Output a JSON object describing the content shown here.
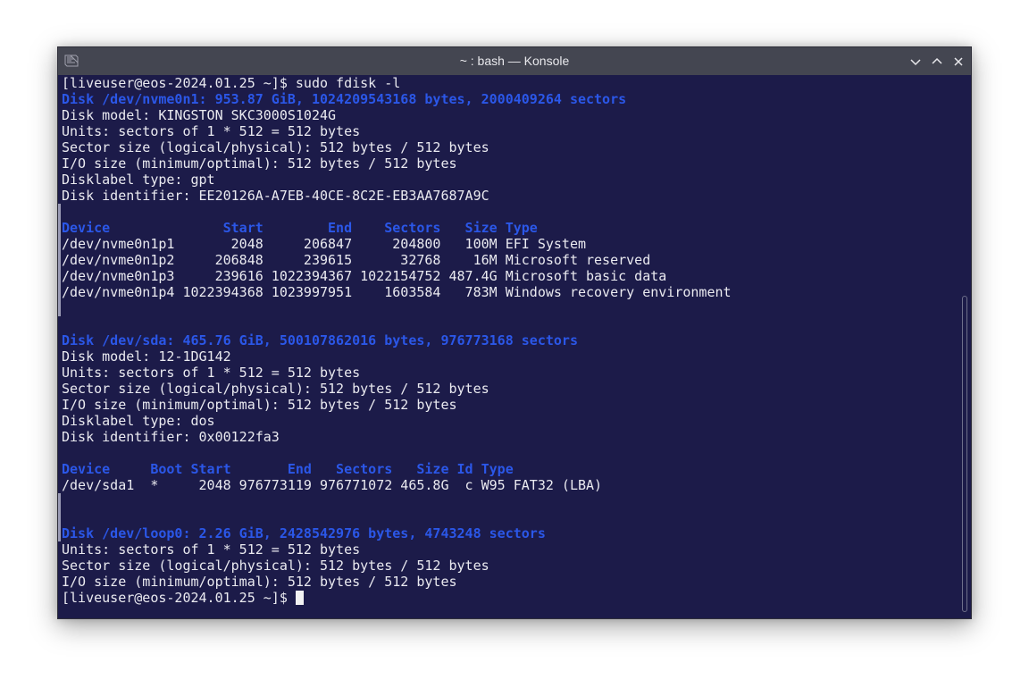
{
  "window": {
    "title": "~ : bash — Konsole",
    "icons": {
      "app": "konsole-app-icon",
      "minimize": "chevron-down-icon",
      "maximize": "chevron-up-icon",
      "close": "close-icon"
    },
    "colors": {
      "terminal_bg": "#1c1b49",
      "titlebar_bg": "#444651",
      "text": "#eaeaf0",
      "highlight": "#2b57e8"
    }
  },
  "terminal": {
    "lines": [
      "[liveuser@eos-2024.01.25 ~]$ sudo fdisk -l",
      "Disk /dev/nvme0n1: 953.87 GiB, 1024209543168 bytes, 2000409264 sectors",
      "Disk model: KINGSTON SKC3000S1024G",
      "Units: sectors of 1 * 512 = 512 bytes",
      "Sector size (logical/physical): 512 bytes / 512 bytes",
      "I/O size (minimum/optimal): 512 bytes / 512 bytes",
      "Disklabel type: gpt",
      "Disk identifier: EE20126A-A7EB-40CE-8C2E-EB3AA7687A9C",
      "",
      "Device              Start        End    Sectors   Size Type",
      "/dev/nvme0n1p1       2048     206847     204800   100M EFI System",
      "/dev/nvme0n1p2     206848     239615      32768    16M Microsoft reserved",
      "/dev/nvme0n1p3     239616 1022394367 1022154752 487.4G Microsoft basic data",
      "/dev/nvme0n1p4 1022394368 1023997951    1603584   783M Windows recovery environment",
      "",
      "",
      "Disk /dev/sda: 465.76 GiB, 500107862016 bytes, 976773168 sectors",
      "Disk model: 12-1DG142",
      "Units: sectors of 1 * 512 = 512 bytes",
      "Sector size (logical/physical): 512 bytes / 512 bytes",
      "I/O size (minimum/optimal): 512 bytes / 512 bytes",
      "Disklabel type: dos",
      "Disk identifier: 0x00122fa3",
      "",
      "Device     Boot Start       End   Sectors   Size Id Type",
      "/dev/sda1  *     2048 976773119 976771072 465.8G  c W95 FAT32 (LBA)",
      "",
      "",
      "Disk /dev/loop0: 2.26 GiB, 2428542976 bytes, 4743248 sectors",
      "Units: sectors of 1 * 512 = 512 bytes",
      "Sector size (logical/physical): 512 bytes / 512 bytes",
      "I/O size (minimum/optimal): 512 bytes / 512 bytes",
      "[liveuser@eos-2024.01.25 ~]$ "
    ],
    "highlighted_lines": [
      1,
      9,
      16,
      24,
      28
    ]
  }
}
